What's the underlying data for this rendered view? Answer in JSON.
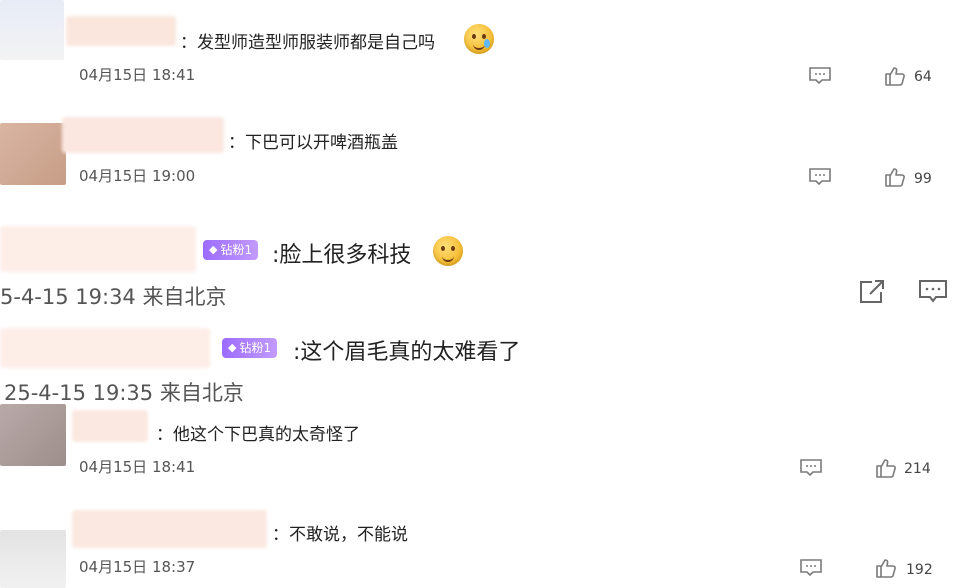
{
  "comments": [
    {
      "text": "发型师造型师服装师都是自己吗",
      "meta": "04月15日 18:41",
      "likes": "64",
      "emoji": "sweat-smile"
    },
    {
      "text": "下巴可以开啤酒瓶盖",
      "meta": "04月15日 19:00",
      "likes": "99"
    },
    {
      "badge": "钻粉1",
      "text": "脸上很多科技",
      "meta": "5-4-15 19:34 来自北京",
      "emoji": "smile"
    },
    {
      "badge": "钻粉1",
      "text": "这个眉毛真的太难看了",
      "meta": "25-4-15 19:35 来自北京"
    },
    {
      "text": "他这个下巴真的太奇怪了",
      "meta": "04月15日 18:41",
      "likes": "214"
    },
    {
      "text": "不敢说，不能说",
      "meta": "04月15日 18:37",
      "likes": "192"
    }
  ],
  "colors": {
    "badge_start": "#9c6cff",
    "badge_end": "#c29bff",
    "username_blur": "#fbe4dc",
    "icon": "#7a7a7a"
  }
}
